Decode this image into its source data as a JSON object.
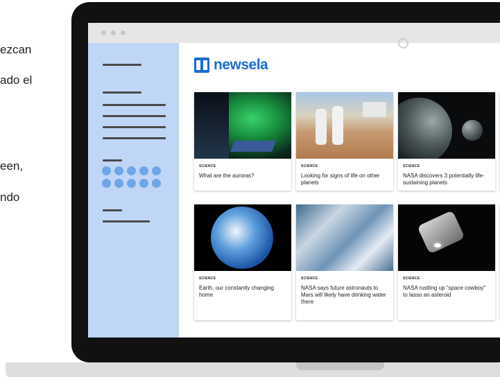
{
  "side_text": [
    "ezcan",
    "ado el",
    "een,",
    "ndo"
  ],
  "app": {
    "logo_text": "newsela"
  },
  "cards": [
    {
      "category": "SCIENCE",
      "title": "What are the auroras?"
    },
    {
      "category": "SCIENCE",
      "title": "Looking for signs of life on other planets"
    },
    {
      "category": "SCIENCE",
      "title": "NASA discovers 3 potentially life-sustaining planets"
    },
    {
      "category": "SCIENCE",
      "title": "Earth, our constantly changing home"
    },
    {
      "category": "SCIENCE",
      "title": "NASA says future astronauts to Mars will likely have drinking water there"
    },
    {
      "category": "SCIENCE",
      "title": "NASA rustling up \"space cowboy\" to lasso an asteroid"
    }
  ],
  "colors": {
    "brand": "#1a6dd1",
    "sidebar": "#bfd6f6",
    "sidebar_dots": "#6fa6e8"
  }
}
